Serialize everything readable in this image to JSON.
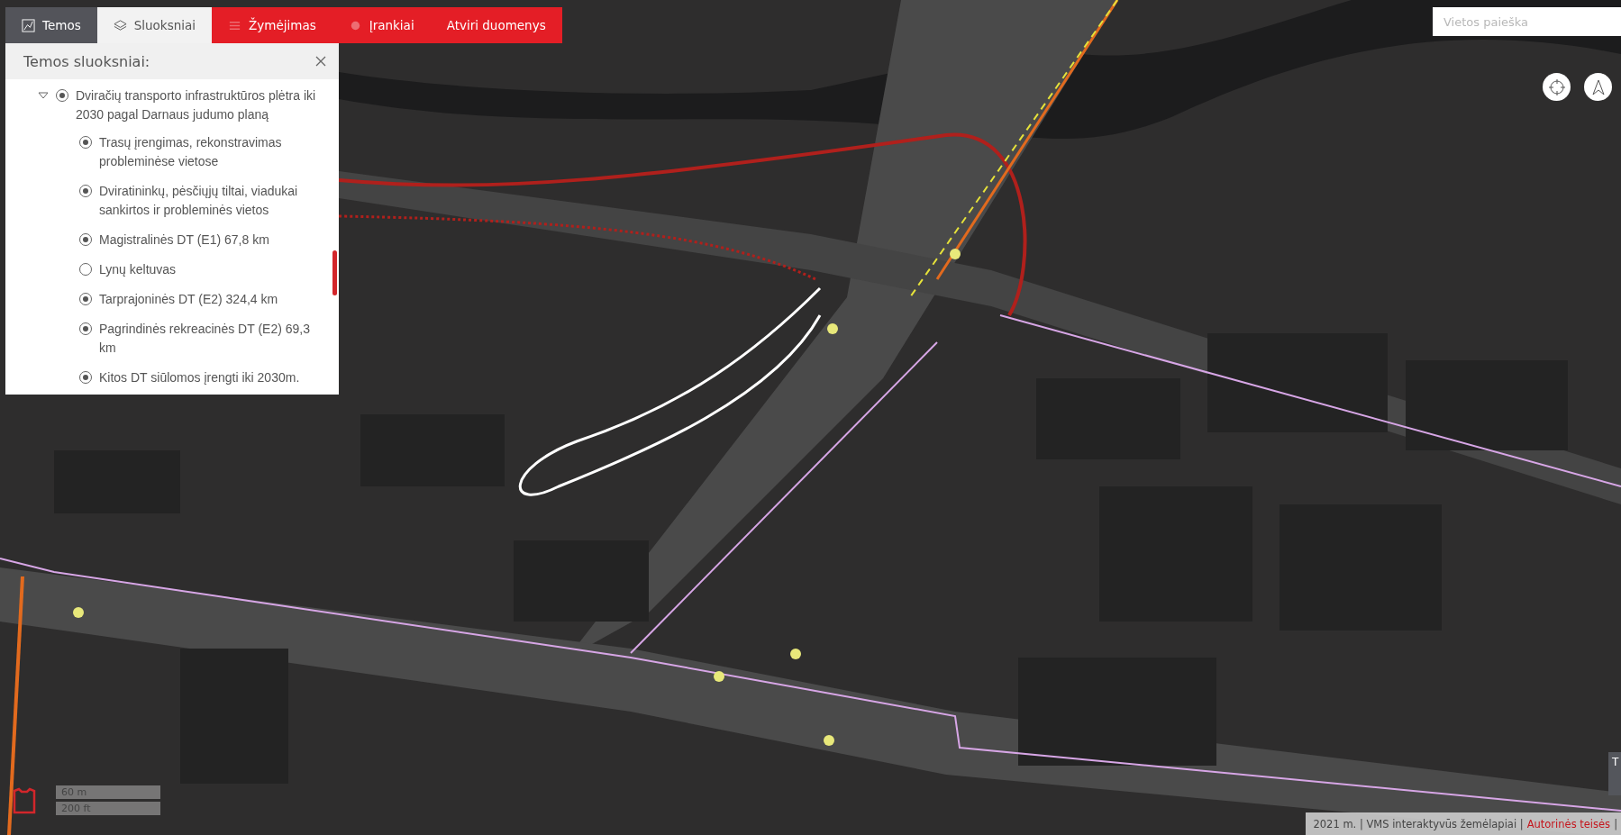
{
  "tabs": [
    {
      "label": "Temos",
      "kind": "themes",
      "selected": false
    },
    {
      "label": "Sluoksniai",
      "kind": "layers",
      "selected": true
    },
    {
      "label": "Žymėjimas",
      "kind": "markup",
      "selected": false
    },
    {
      "label": "Įrankiai",
      "kind": "tools",
      "selected": false
    },
    {
      "label": "Atviri duomenys",
      "kind": "data",
      "selected": false
    }
  ],
  "panel": {
    "title": "Temos sluoksniai:",
    "layers": [
      {
        "label": "Dviračių transporto infrastruktūros plėtra iki 2030 pagal Darnaus judumo planą",
        "checked": true,
        "expanded": true,
        "children": [
          {
            "label": "Trasų įrengimas, rekonstravimas probleminėse vietose",
            "checked": true
          },
          {
            "label": "Dviratininkų, pėsčiųjų tiltai, viadukai sankirtos ir probleminės vietos",
            "checked": true
          },
          {
            "label": "Magistralinės DT (E1) 67,8 km",
            "checked": true
          },
          {
            "label": "Lynų keltuvas",
            "checked": false
          },
          {
            "label": "Tarprajoninės DT (E2) 324,4 km",
            "checked": true
          },
          {
            "label": "Pagrindinės rekreacinės DT (E2) 69,3 km",
            "checked": true
          },
          {
            "label": "Kitos DT siūlomos įrengti iki 2030m.",
            "checked": true
          }
        ]
      }
    ]
  },
  "search": {
    "placeholder": "Vietos paieška"
  },
  "scale": [
    "60 m",
    "200 ft"
  ],
  "side_widget": {
    "label": "T"
  },
  "attribution": {
    "text": "2021 m. | VMS interaktyvūs žemėlapiai |",
    "link": "Autorinės teisės",
    "after": "|"
  }
}
